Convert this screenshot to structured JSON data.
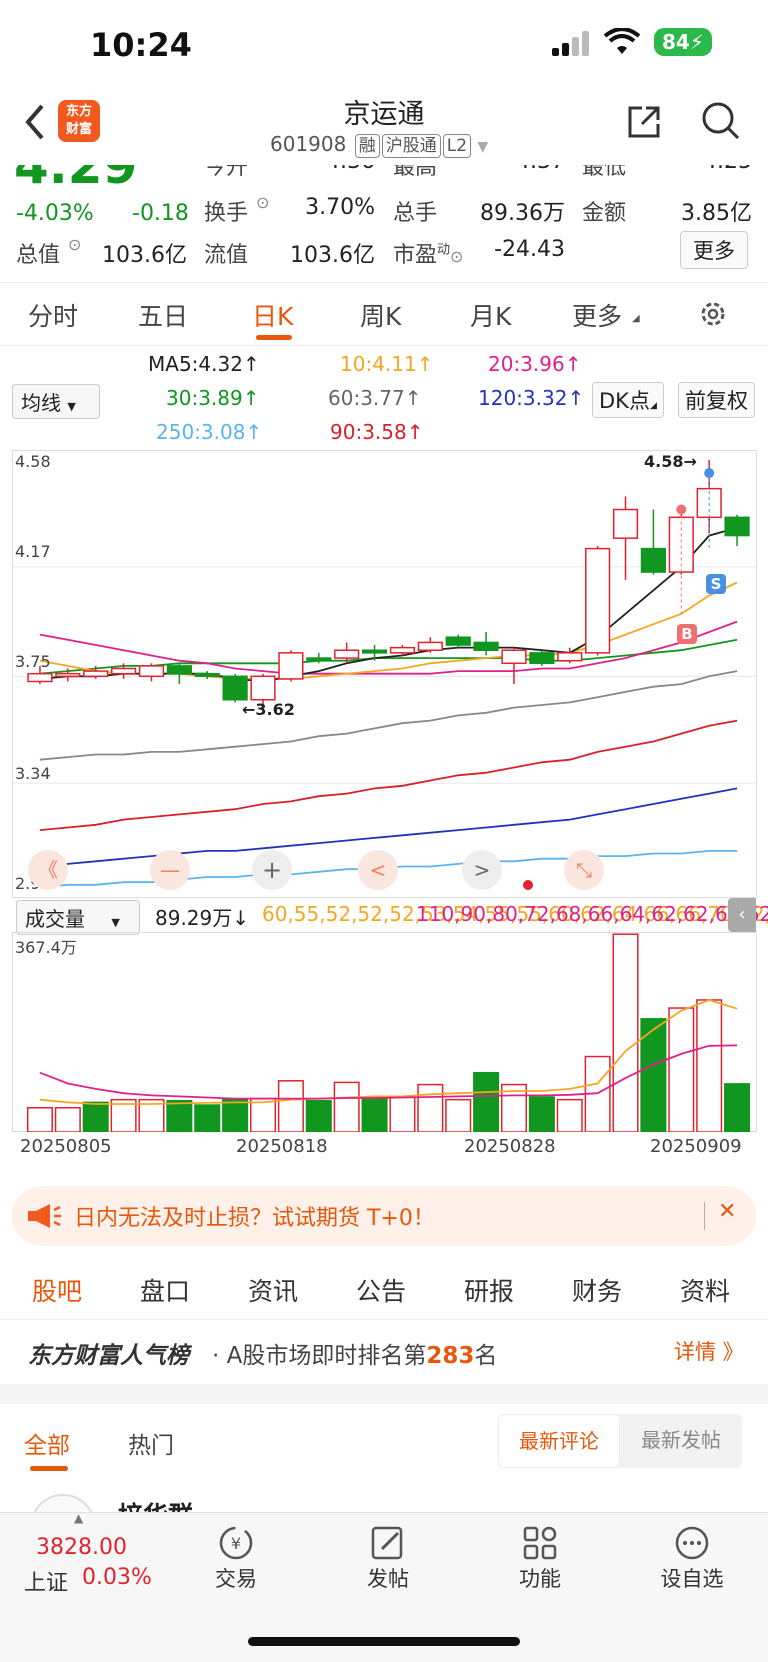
{
  "status": {
    "time": "10:24",
    "battery": "84"
  },
  "nav": {
    "title": "京运通",
    "code": "601908",
    "tags": [
      "融",
      "沪股通",
      "L2"
    ]
  },
  "quote": {
    "price": "4.29",
    "change_pct": "-4.03%",
    "change": "-0.18",
    "row0": {
      "open_label": "今开",
      "open": "4.36",
      "high_label": "最高",
      "high": "4.37",
      "low_label": "最低",
      "low": "4.25"
    },
    "row1": {
      "turnover_label": "换手",
      "turnover": "3.70%",
      "vol_label": "总手",
      "vol": "89.36万",
      "amt_label": "金额",
      "amt": "3.85亿"
    },
    "row2": {
      "mcap_label": "总值",
      "mcap": "103.6亿",
      "float_label": "流值",
      "float": "103.6亿",
      "pe_label": "市盈",
      "pe_sup": "动",
      "pe": "-24.43",
      "more": "更多"
    }
  },
  "tabs": [
    "分时",
    "五日",
    "日K",
    "周K",
    "月K",
    "更多"
  ],
  "active_tab": "日K",
  "ma": {
    "select": "均线",
    "ma5": "MA5:4.32",
    "ma10": "10:4.11",
    "ma20": "20:3.96",
    "ma30": "30:3.89",
    "ma60": "60:3.77",
    "ma120": "120:3.32",
    "ma250": "250:3.08",
    "ma90": "90:3.58",
    "dk": "DK点",
    "adjust": "前复权",
    "colors": {
      "ma5": "#222222",
      "ma10": "#f5a623",
      "ma20": "#e0218a",
      "ma30": "#11961f",
      "ma60": "#888888",
      "ma120": "#2333b8",
      "ma250": "#5ab4ef",
      "ma90": "#d8202a"
    }
  },
  "chart_data": [
    {
      "type": "candlestick",
      "y_ticks": [
        "4.58",
        "4.17",
        "3.75",
        "3.34",
        "2.93"
      ],
      "ylim": [
        2.93,
        4.58
      ],
      "annotations": {
        "high": "4.58→",
        "low": "←3.62",
        "buy": "B",
        "sell": "S"
      },
      "candles": [
        {
          "o": 3.73,
          "c": 3.76,
          "h": 3.79,
          "l": 3.72
        },
        {
          "o": 3.75,
          "c": 3.76,
          "h": 3.78,
          "l": 3.73
        },
        {
          "o": 3.75,
          "c": 3.77,
          "h": 3.79,
          "l": 3.74
        },
        {
          "o": 3.76,
          "c": 3.78,
          "h": 3.8,
          "l": 3.74
        },
        {
          "o": 3.75,
          "c": 3.79,
          "h": 3.8,
          "l": 3.73
        },
        {
          "o": 3.79,
          "c": 3.76,
          "h": 3.8,
          "l": 3.72
        },
        {
          "o": 3.76,
          "c": 3.75,
          "h": 3.77,
          "l": 3.74
        },
        {
          "o": 3.75,
          "c": 3.66,
          "h": 3.76,
          "l": 3.65
        },
        {
          "o": 3.66,
          "c": 3.75,
          "h": 3.76,
          "l": 3.62
        },
        {
          "o": 3.74,
          "c": 3.84,
          "h": 3.85,
          "l": 3.73
        },
        {
          "o": 3.82,
          "c": 3.81,
          "h": 3.84,
          "l": 3.8
        },
        {
          "o": 3.82,
          "c": 3.85,
          "h": 3.88,
          "l": 3.8
        },
        {
          "o": 3.85,
          "c": 3.84,
          "h": 3.87,
          "l": 3.81
        },
        {
          "o": 3.84,
          "c": 3.86,
          "h": 3.87,
          "l": 3.83
        },
        {
          "o": 3.85,
          "c": 3.88,
          "h": 3.9,
          "l": 3.84
        },
        {
          "o": 3.9,
          "c": 3.87,
          "h": 3.91,
          "l": 3.86
        },
        {
          "o": 3.88,
          "c": 3.85,
          "h": 3.92,
          "l": 3.83
        },
        {
          "o": 3.8,
          "c": 3.85,
          "h": 3.86,
          "l": 3.72
        },
        {
          "o": 3.84,
          "c": 3.8,
          "h": 3.85,
          "l": 3.79
        },
        {
          "o": 3.81,
          "c": 3.84,
          "h": 3.86,
          "l": 3.8
        },
        {
          "o": 3.84,
          "c": 4.24,
          "h": 4.25,
          "l": 3.83
        },
        {
          "o": 4.28,
          "c": 4.39,
          "h": 4.44,
          "l": 4.12
        },
        {
          "o": 4.24,
          "c": 4.15,
          "h": 4.39,
          "l": 4.14
        },
        {
          "o": 4.15,
          "c": 4.36,
          "h": 4.4,
          "l": 4.14
        },
        {
          "o": 4.36,
          "c": 4.47,
          "h": 4.58,
          "l": 4.3
        },
        {
          "o": 4.36,
          "c": 4.29,
          "h": 4.37,
          "l": 4.25
        }
      ],
      "ma5": [
        3.74,
        3.75,
        3.75,
        3.76,
        3.76,
        3.76,
        3.76,
        3.74,
        3.73,
        3.75,
        3.77,
        3.8,
        3.82,
        3.83,
        3.85,
        3.86,
        3.86,
        3.86,
        3.85,
        3.84,
        3.9,
        3.99,
        4.08,
        4.17,
        4.29,
        4.32
      ],
      "ma10": [
        3.81,
        3.79,
        3.77,
        3.76,
        3.76,
        3.76,
        3.75,
        3.74,
        3.74,
        3.74,
        3.75,
        3.76,
        3.77,
        3.78,
        3.8,
        3.81,
        3.82,
        3.83,
        3.83,
        3.84,
        3.87,
        3.91,
        3.95,
        3.99,
        4.06,
        4.11
      ],
      "ma20": [
        3.91,
        3.89,
        3.87,
        3.85,
        3.83,
        3.81,
        3.8,
        3.78,
        3.77,
        3.76,
        3.76,
        3.76,
        3.76,
        3.76,
        3.76,
        3.77,
        3.77,
        3.77,
        3.78,
        3.78,
        3.8,
        3.82,
        3.85,
        3.88,
        3.92,
        3.96
      ],
      "ma30": [
        3.76,
        3.77,
        3.78,
        3.79,
        3.79,
        3.8,
        3.8,
        3.8,
        3.8,
        3.8,
        3.81,
        3.81,
        3.82,
        3.82,
        3.82,
        3.82,
        3.82,
        3.82,
        3.81,
        3.81,
        3.82,
        3.83,
        3.84,
        3.85,
        3.87,
        3.89
      ],
      "ma60": [
        3.43,
        3.44,
        3.45,
        3.45,
        3.46,
        3.46,
        3.47,
        3.48,
        3.49,
        3.5,
        3.52,
        3.53,
        3.55,
        3.57,
        3.58,
        3.6,
        3.61,
        3.63,
        3.64,
        3.65,
        3.67,
        3.69,
        3.71,
        3.72,
        3.75,
        3.77
      ],
      "ma90": [
        3.16,
        3.17,
        3.18,
        3.2,
        3.21,
        3.22,
        3.23,
        3.24,
        3.26,
        3.27,
        3.29,
        3.3,
        3.32,
        3.33,
        3.35,
        3.37,
        3.38,
        3.4,
        3.42,
        3.43,
        3.46,
        3.48,
        3.5,
        3.53,
        3.56,
        3.58
      ],
      "ma120": [
        3.02,
        3.03,
        3.04,
        3.05,
        3.06,
        3.07,
        3.08,
        3.08,
        3.09,
        3.1,
        3.11,
        3.12,
        3.13,
        3.14,
        3.15,
        3.16,
        3.17,
        3.18,
        3.19,
        3.2,
        3.22,
        3.24,
        3.26,
        3.28,
        3.3,
        3.32
      ],
      "ma250": [
        2.94,
        2.95,
        2.95,
        2.96,
        2.96,
        2.97,
        2.98,
        2.98,
        2.99,
        2.99,
        3.0,
        3.01,
        3.01,
        3.02,
        3.02,
        3.03,
        3.04,
        3.04,
        3.05,
        3.05,
        3.06,
        3.06,
        3.07,
        3.07,
        3.08,
        3.08
      ]
    },
    {
      "type": "bar",
      "label_select": "成交量",
      "vol_value": "89.29万",
      "ma1": [
        60,
        55,
        52,
        52,
        52,
        53,
        54,
        55,
        55,
        60,
        62,
        64,
        66,
        66,
        70,
        72,
        74,
        76,
        76,
        80,
        90,
        150,
        190,
        225,
        245,
        228.7
      ],
      "ma2": [
        110,
        90,
        80,
        72,
        68,
        66,
        64,
        62,
        62,
        62,
        62,
        63,
        63,
        64,
        65,
        66,
        67,
        68,
        68,
        69,
        72,
        100,
        125,
        145,
        160,
        160.7
      ],
      "y_max_label": "367.4万",
      "ylim": [
        0,
        367.4
      ],
      "x_labels": [
        "20250805",
        "20250818",
        "20250828",
        "20250909"
      ],
      "values": [
        45,
        45,
        55,
        60,
        60,
        58,
        50,
        60,
        62,
        95,
        58,
        92,
        65,
        65,
        88,
        60,
        110,
        88,
        65,
        60,
        140,
        367,
        210,
        230,
        245,
        89.29
      ],
      "up": [
        true,
        true,
        false,
        true,
        true,
        false,
        false,
        false,
        true,
        true,
        false,
        true,
        false,
        true,
        true,
        true,
        false,
        true,
        false,
        true,
        true,
        true,
        false,
        true,
        true,
        false
      ]
    }
  ],
  "chart_controls": [
    "《",
    "—",
    "+",
    "<",
    ">",
    "⤡"
  ],
  "banner": {
    "text": "日内无法及时止损？试试期货 T+0！",
    "close": "✕"
  },
  "subtabs": [
    "股吧",
    "盘口",
    "资讯",
    "公告",
    "研报",
    "财务",
    "资料"
  ],
  "active_subtab": "股吧",
  "rank": {
    "brand": "东方财富人气榜",
    "text": "· A股市场即时排名第",
    "num": "283",
    "suffix": "名",
    "detail": "详情 》"
  },
  "filter": {
    "all": "全部",
    "hot": "热门",
    "latest_comment": "最新评论",
    "latest_post": "最新发帖"
  },
  "post_author": "培华群",
  "bottom": {
    "index_value": "3828.00",
    "index_name": "上证",
    "index_change": "0.03%",
    "nav": [
      "交易",
      "发帖",
      "功能",
      "设自选"
    ]
  },
  "colors": {
    "up": "#e1232f",
    "down": "#11961f",
    "accent": "#e8580c"
  }
}
